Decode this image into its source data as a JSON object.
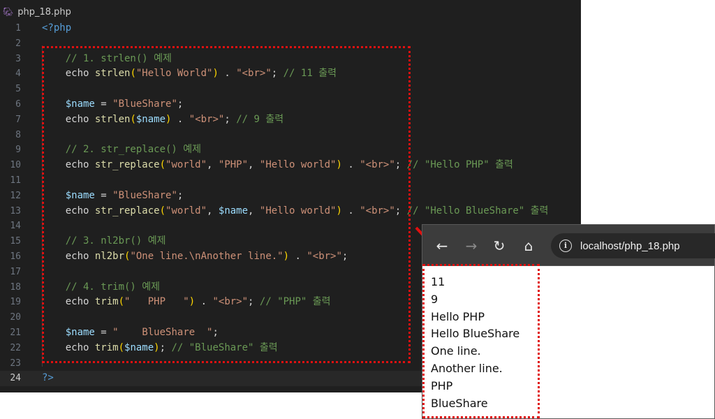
{
  "editor": {
    "tab_title": "php_18.php",
    "tab_icon": "php-elephant-icon",
    "active_line": 24,
    "lines": [
      {
        "n": "1",
        "tokens": [
          [
            "phptag",
            "<?php"
          ]
        ]
      },
      {
        "n": "2",
        "tokens": []
      },
      {
        "n": "3",
        "tokens": [
          [
            "plain",
            "    "
          ],
          [
            "cmt",
            "// 1. strlen() 예제"
          ]
        ]
      },
      {
        "n": "4",
        "tokens": [
          [
            "plain",
            "    echo "
          ],
          [
            "fn",
            "strlen"
          ],
          [
            "paren",
            "("
          ],
          [
            "str",
            "\"Hello World\""
          ],
          [
            "paren",
            ")"
          ],
          [
            "plain",
            " . "
          ],
          [
            "str",
            "\"<br>\""
          ],
          [
            "plain",
            "; "
          ],
          [
            "cmt",
            "// 11 출력"
          ]
        ]
      },
      {
        "n": "5",
        "tokens": []
      },
      {
        "n": "6",
        "tokens": [
          [
            "plain",
            "    "
          ],
          [
            "var",
            "$name"
          ],
          [
            "plain",
            " = "
          ],
          [
            "str",
            "\"BlueShare\""
          ],
          [
            "plain",
            ";"
          ]
        ]
      },
      {
        "n": "7",
        "tokens": [
          [
            "plain",
            "    echo "
          ],
          [
            "fn",
            "strlen"
          ],
          [
            "paren",
            "("
          ],
          [
            "var",
            "$name"
          ],
          [
            "paren",
            ")"
          ],
          [
            "plain",
            " . "
          ],
          [
            "str",
            "\"<br>\""
          ],
          [
            "plain",
            "; "
          ],
          [
            "cmt",
            "// 9 출력"
          ]
        ]
      },
      {
        "n": "8",
        "tokens": []
      },
      {
        "n": "9",
        "tokens": [
          [
            "plain",
            "    "
          ],
          [
            "cmt",
            "// 2. str_replace() 예제"
          ]
        ]
      },
      {
        "n": "10",
        "tokens": [
          [
            "plain",
            "    echo "
          ],
          [
            "fn",
            "str_replace"
          ],
          [
            "paren",
            "("
          ],
          [
            "str",
            "\"world\""
          ],
          [
            "plain",
            ", "
          ],
          [
            "str",
            "\"PHP\""
          ],
          [
            "plain",
            ", "
          ],
          [
            "str",
            "\"Hello world\""
          ],
          [
            "paren",
            ")"
          ],
          [
            "plain",
            " . "
          ],
          [
            "str",
            "\"<br>\""
          ],
          [
            "plain",
            "; "
          ],
          [
            "cmt",
            "// \"Hello PHP\" 출력"
          ]
        ]
      },
      {
        "n": "11",
        "tokens": []
      },
      {
        "n": "12",
        "tokens": [
          [
            "plain",
            "    "
          ],
          [
            "var",
            "$name"
          ],
          [
            "plain",
            " = "
          ],
          [
            "str",
            "\"BlueShare\""
          ],
          [
            "plain",
            ";"
          ]
        ]
      },
      {
        "n": "13",
        "tokens": [
          [
            "plain",
            "    echo "
          ],
          [
            "fn",
            "str_replace"
          ],
          [
            "paren",
            "("
          ],
          [
            "str",
            "\"world\""
          ],
          [
            "plain",
            ", "
          ],
          [
            "var",
            "$name"
          ],
          [
            "plain",
            ", "
          ],
          [
            "str",
            "\"Hello world\""
          ],
          [
            "paren",
            ")"
          ],
          [
            "plain",
            " . "
          ],
          [
            "str",
            "\"<br>\""
          ],
          [
            "plain",
            "; "
          ],
          [
            "cmt",
            "// \"Hello BlueShare\" 출력"
          ]
        ]
      },
      {
        "n": "14",
        "tokens": []
      },
      {
        "n": "15",
        "tokens": [
          [
            "plain",
            "    "
          ],
          [
            "cmt",
            "// 3. nl2br() 예제"
          ]
        ]
      },
      {
        "n": "16",
        "tokens": [
          [
            "plain",
            "    echo "
          ],
          [
            "fn",
            "nl2br"
          ],
          [
            "paren",
            "("
          ],
          [
            "str",
            "\"One line.\\nAnother line.\""
          ],
          [
            "paren",
            ")"
          ],
          [
            "plain",
            " . "
          ],
          [
            "str",
            "\"<br>\""
          ],
          [
            "plain",
            ";"
          ]
        ]
      },
      {
        "n": "17",
        "tokens": []
      },
      {
        "n": "18",
        "tokens": [
          [
            "plain",
            "    "
          ],
          [
            "cmt",
            "// 4. trim() 예제"
          ]
        ]
      },
      {
        "n": "19",
        "tokens": [
          [
            "plain",
            "    echo "
          ],
          [
            "fn",
            "trim"
          ],
          [
            "paren",
            "("
          ],
          [
            "str",
            "\"   PHP   \""
          ],
          [
            "paren",
            ")"
          ],
          [
            "plain",
            " . "
          ],
          [
            "str",
            "\"<br>\""
          ],
          [
            "plain",
            "; "
          ],
          [
            "cmt",
            "// \"PHP\" 출력"
          ]
        ]
      },
      {
        "n": "20",
        "tokens": []
      },
      {
        "n": "21",
        "tokens": [
          [
            "plain",
            "    "
          ],
          [
            "var",
            "$name"
          ],
          [
            "plain",
            " = "
          ],
          [
            "str",
            "\"    BlueShare  \""
          ],
          [
            "plain",
            ";"
          ]
        ]
      },
      {
        "n": "22",
        "tokens": [
          [
            "plain",
            "    echo "
          ],
          [
            "fn",
            "trim"
          ],
          [
            "paren",
            "("
          ],
          [
            "var",
            "$name"
          ],
          [
            "paren",
            ")"
          ],
          [
            "plain",
            "; "
          ],
          [
            "cmt",
            "// \"BlueShare\" 출력"
          ]
        ]
      },
      {
        "n": "23",
        "tokens": []
      },
      {
        "n": "24",
        "tokens": [
          [
            "phptag",
            "?>"
          ]
        ]
      }
    ]
  },
  "browser": {
    "back_icon": "arrow-left-icon",
    "forward_icon": "arrow-right-icon",
    "reload_icon": "reload-icon",
    "home_icon": "home-icon",
    "info_icon": "info-icon",
    "url": "localhost/php_18.php",
    "output_lines": [
      "11",
      "9",
      "Hello PHP",
      "Hello BlueShare",
      "One line.",
      "Another line.",
      "PHP",
      "BlueShare"
    ]
  },
  "annotation": {
    "highlight_color": "#e01010",
    "arrow_icon": "red-arrow-icon"
  }
}
